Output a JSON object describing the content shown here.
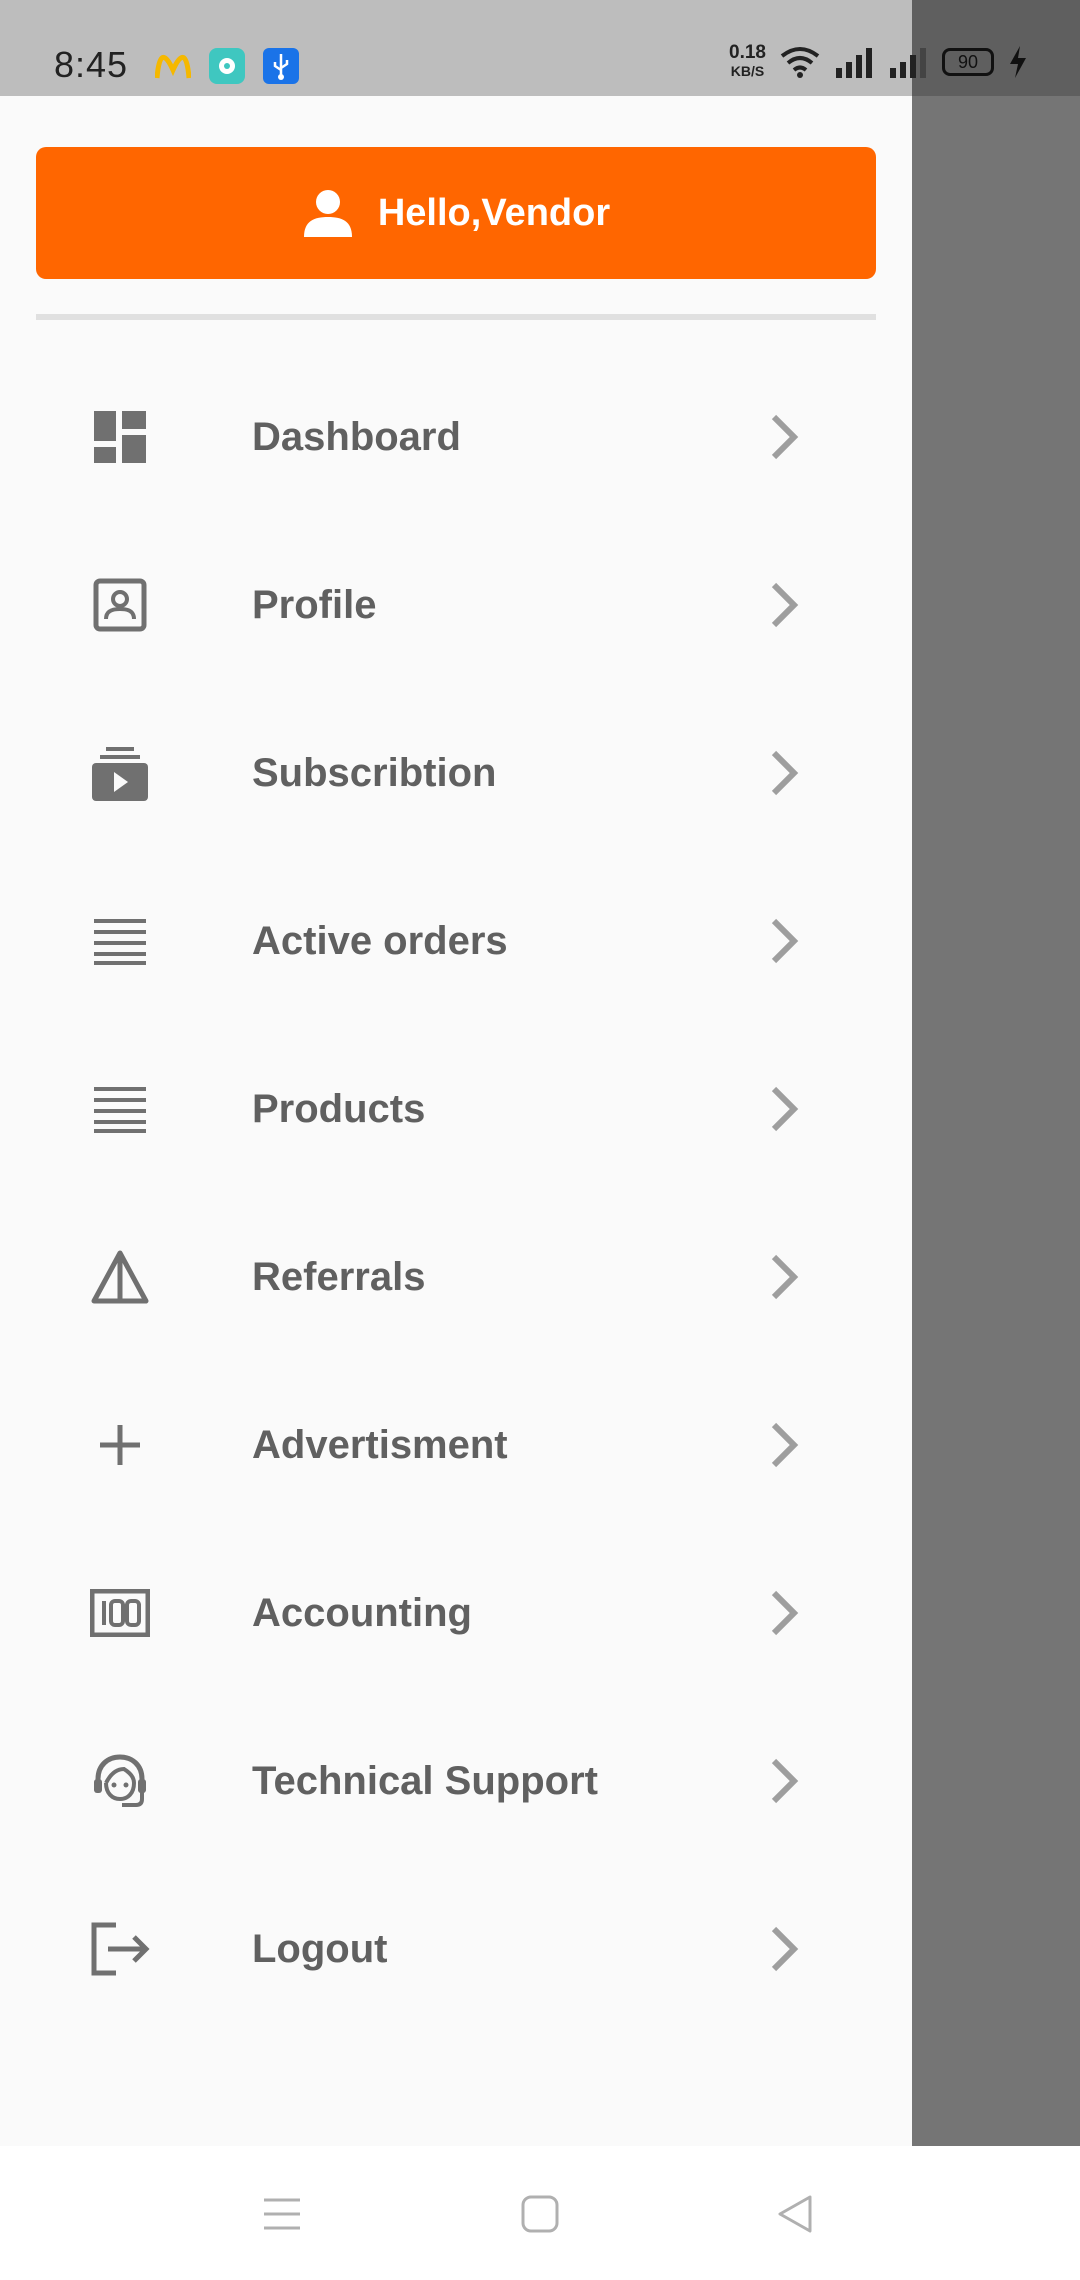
{
  "status_bar": {
    "time": "8:45",
    "net_speed_value": "0.18",
    "net_speed_unit": "KB/S",
    "battery": "90",
    "icons": [
      "mcdonalds-app-icon",
      "camera-app-icon",
      "usb-icon",
      "wifi-icon",
      "signal-icon",
      "signal-icon-2",
      "battery-icon",
      "charging-icon"
    ]
  },
  "header": {
    "greeting": "Hello,Vendor",
    "icon": "person-icon",
    "accent_color": "#ff6600"
  },
  "menu": {
    "items": [
      {
        "label": "Dashboard",
        "icon": "dashboard-icon"
      },
      {
        "label": "Profile",
        "icon": "profile-icon"
      },
      {
        "label": "Subscribtion",
        "icon": "subscription-icon"
      },
      {
        "label": "Active orders",
        "icon": "list-icon"
      },
      {
        "label": "Products",
        "icon": "list-icon"
      },
      {
        "label": "Referrals",
        "icon": "triangle-icon"
      },
      {
        "label": "Advertisment",
        "icon": "plus-icon"
      },
      {
        "label": "Accounting",
        "icon": "counter-icon"
      },
      {
        "label": "Technical Support",
        "icon": "support-agent-icon"
      },
      {
        "label": "Logout",
        "icon": "logout-icon"
      }
    ]
  },
  "nav_bar": {
    "buttons": [
      "menu-icon",
      "home-icon",
      "back-icon"
    ]
  }
}
